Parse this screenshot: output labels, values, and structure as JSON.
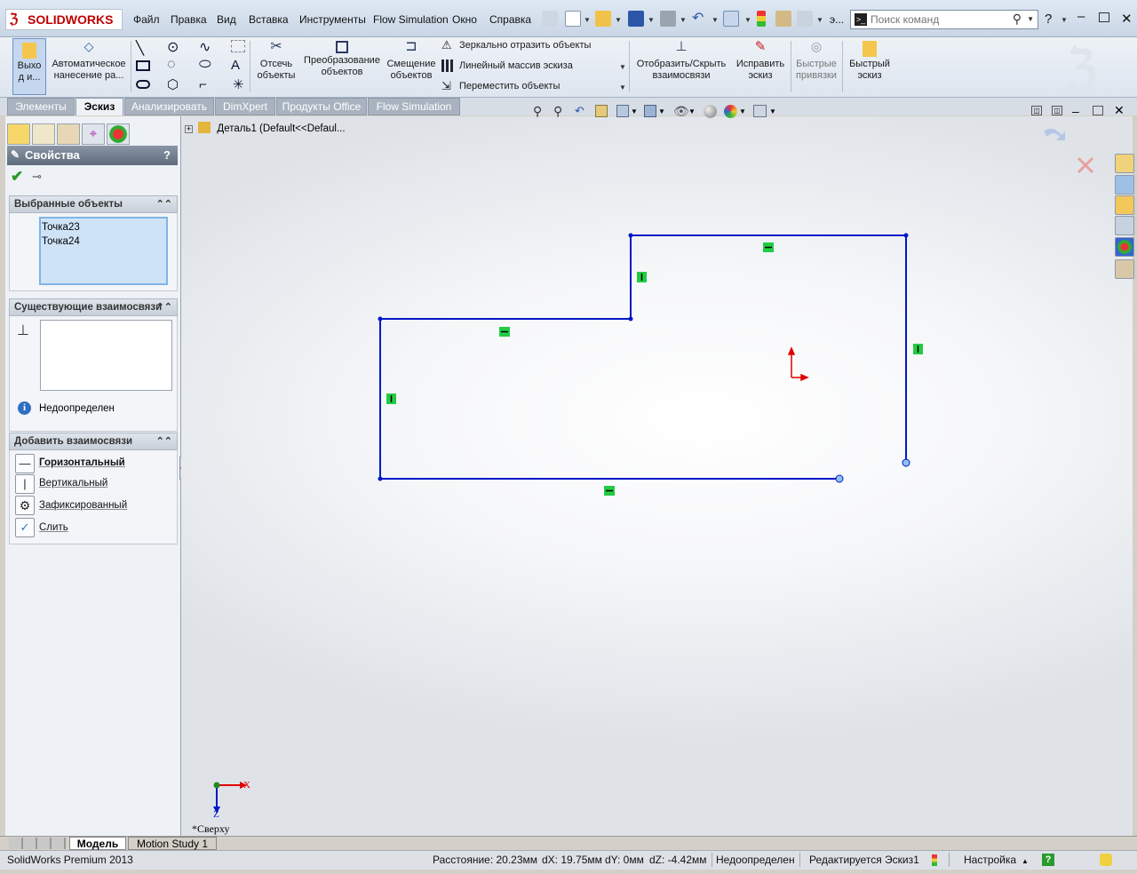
{
  "app": {
    "logo_text": "SOLIDWORKS"
  },
  "menu": [
    "Файл",
    "Правка",
    "Вид",
    "Вставка",
    "Инструменты",
    "Flow Simulation",
    "Окно",
    "Справка"
  ],
  "search": {
    "placeholder": "Поиск команд",
    "overflow_label": "э..."
  },
  "command_manager": {
    "exit_sketch": "Выхо д и...",
    "auto_dimension": "Автоматическое нанесение ра...",
    "trim": "Отсечь объекты",
    "convert": "Преобразование объектов",
    "offset": "Смещение объектов",
    "mirror": "Зеркально отразить объекты",
    "linear_pattern": "Линейный массив эскиза",
    "move": "Переместить объекты",
    "show_hide_relations": "Отобразить/Скрыть взаимосвязи",
    "repair": "Исправить эскиз",
    "quick_snaps": "Быстрые привязки",
    "rapid_sketch": "Быстрый эскиз"
  },
  "tabs": [
    "Элементы",
    "Эскиз",
    "Анализировать",
    "DimXpert",
    "Продукты Office",
    "Flow Simulation"
  ],
  "active_tab": "Эскиз",
  "property_manager": {
    "title": "Свойства",
    "help": "?",
    "selected_group": "Выбранные объекты",
    "selected_items": [
      "Точка23",
      "Точка24"
    ],
    "existing_group": "Существующие взаимосвязи",
    "status_text": "Недоопределен",
    "add_group": "Добавить взаимосвязи",
    "relations": [
      "Горизонтальный",
      "Вертикальный",
      "Зафиксированный",
      "Слить"
    ]
  },
  "feature_tree": {
    "root": "Деталь1  (Default<<Defaul..."
  },
  "view": {
    "orientation_label": "*Сверху",
    "axis_x": "X",
    "axis_z": "Z"
  },
  "bottom_tabs": [
    "Модель",
    "Motion Study 1"
  ],
  "status": {
    "product": "SolidWorks Premium 2013",
    "distance": "Расстояние: 20.23мм",
    "dx": "dX: 19.75мм",
    "dy": "dY: 0мм",
    "dz": "dZ: -4.42мм",
    "definition": "Недоопределен",
    "editing": "Редактируется Эскиз1",
    "settings": "Настройка"
  },
  "colors": {
    "sketch": "#0018c8",
    "relation": "#22cc44",
    "origin": "#e00000",
    "accent": "#c00000"
  }
}
